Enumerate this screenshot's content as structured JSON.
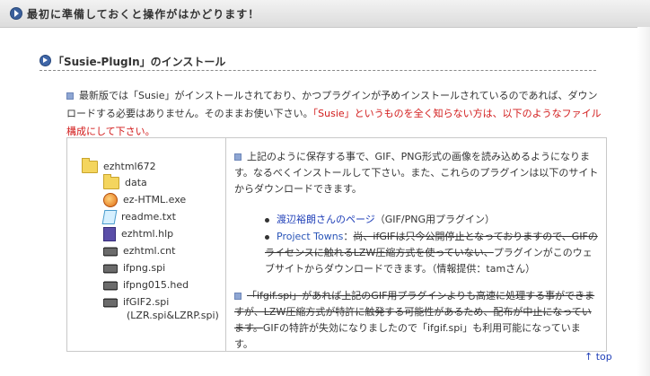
{
  "banner": {
    "title": "最初に準備しておくと操作がはかどります！",
    "icon": "arrow-circle-icon"
  },
  "section": {
    "title": "「Susie-PlugIn」のインストール",
    "icon": "arrow-circle-icon"
  },
  "intro": {
    "text_normal": "最新版では「Susie」がインストールされており、かつプラグインが予めインストールされているのであれば、ダウンロードする必要はありません。そのままお使い下さい。",
    "text_red": "「Susie」というものを全く知らない方は、以下のようなファイル構成にして下さい。"
  },
  "file_tree": {
    "root": "ezhtml672",
    "items": [
      {
        "name": "data",
        "icon": "folder-icon"
      },
      {
        "name": "ez-HTML.exe",
        "icon": "exe-icon"
      },
      {
        "name": "readme.txt",
        "icon": "text-file-icon"
      },
      {
        "name": "ezhtml.hlp",
        "icon": "help-file-icon"
      },
      {
        "name": "ezhtml.cnt",
        "icon": "plugin-chip-icon"
      },
      {
        "name": "ifpng.spi",
        "icon": "plugin-chip-icon"
      },
      {
        "name": "ifpng015.hed",
        "icon": "plugin-chip-icon"
      },
      {
        "name": "ifGIF2.spi",
        "icon": "plugin-chip-icon",
        "sub": "(LZR.spi&LZRP.spi)"
      }
    ]
  },
  "info": {
    "para1": "上記のように保存する事で、GIF、PNG形式の画像を読み込めるようになります。なるべくインストールして下さい。また、これらのプラグインは以下のサイトからダウンロードできます。",
    "link1": "渡辺裕朗さんのページ",
    "link1_note": "（GIF/PNG用プラグイン）",
    "link2": "Project Towns",
    "link2_colon": "：",
    "link2_struck": "尚、ifGIFは只今公開停止となっておりますので、GIFのライセンスに触れるLZW圧縮方式を使っていない、",
    "link2_rest": "プラグインがこのウェブサイトからダウンロードできます。（情報提供：tamさん）",
    "para2_struck": "「ifgif.spi」があれば上記のGIF用プラグインよりも高速に処理する事ができますが、LZW圧縮方式が特許に触発する可能性があるため、配布が中止になっています。",
    "para2_rest": "GIFの特許が失効になりましたので「ifgif.spi」も利用可能になっています。"
  },
  "footer": {
    "top_link": "↑ top"
  }
}
